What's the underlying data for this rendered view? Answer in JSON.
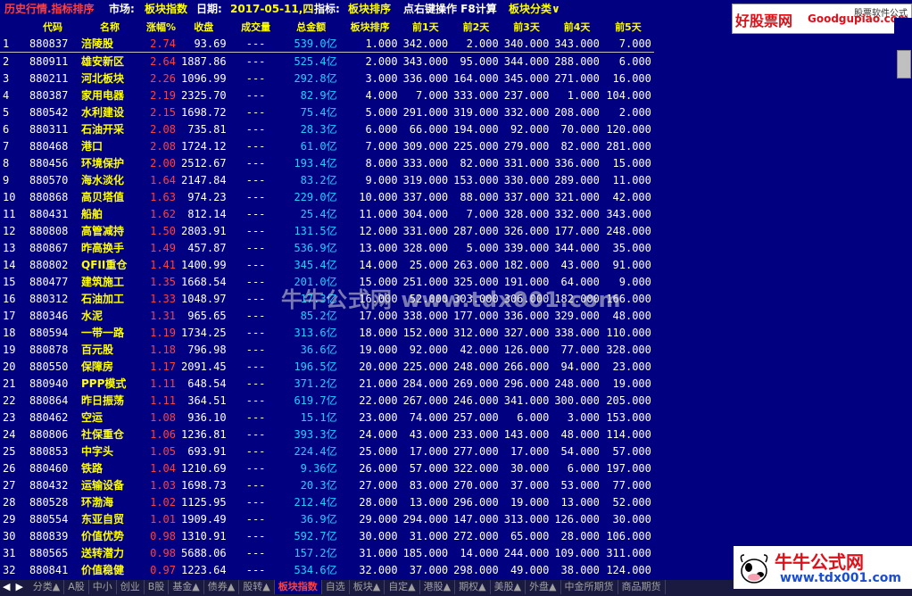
{
  "header": {
    "title": "历史行情.指标排序",
    "market_label": "市场:",
    "market_value": "板块指数",
    "date_label": "日期:",
    "date_value": "2017-05-11,四",
    "indicator_label": "指标:",
    "indicator_value": "板块排序",
    "hint": "点右键操作 F8计算",
    "category": "板块分类∨"
  },
  "brand_top": {
    "cn": "好股票网",
    "en": "Goodgupiao.com",
    "tag": "股票软件公式"
  },
  "columns": [
    "代码",
    "名称",
    "涨幅%",
    "收盘",
    "成交量",
    "总金额",
    "板块排序",
    "前1天",
    "前2天",
    "前3天",
    "前4天",
    "前5天"
  ],
  "rows": [
    [
      "1",
      "880837",
      "涪陵股",
      "2.74",
      "93.69",
      "---",
      "539.0亿",
      "1.000",
      "342.000",
      "2.000",
      "340.000",
      "343.000",
      "7.000"
    ],
    [
      "2",
      "880911",
      "雄安新区",
      "2.64",
      "1887.86",
      "---",
      "525.4亿",
      "2.000",
      "343.000",
      "95.000",
      "344.000",
      "288.000",
      "6.000"
    ],
    [
      "3",
      "880211",
      "河北板块",
      "2.26",
      "1096.99",
      "---",
      "292.8亿",
      "3.000",
      "336.000",
      "164.000",
      "345.000",
      "271.000",
      "16.000"
    ],
    [
      "4",
      "880387",
      "家用电器",
      "2.19",
      "2325.70",
      "---",
      "82.9亿",
      "4.000",
      "7.000",
      "333.000",
      "237.000",
      "1.000",
      "104.000"
    ],
    [
      "5",
      "880542",
      "水利建设",
      "2.15",
      "1698.72",
      "---",
      "75.4亿",
      "5.000",
      "291.000",
      "319.000",
      "332.000",
      "208.000",
      "2.000"
    ],
    [
      "6",
      "880311",
      "石油开采",
      "2.08",
      "735.81",
      "---",
      "28.3亿",
      "6.000",
      "66.000",
      "194.000",
      "92.000",
      "70.000",
      "120.000"
    ],
    [
      "7",
      "880468",
      "港口",
      "2.08",
      "1724.12",
      "---",
      "61.0亿",
      "7.000",
      "309.000",
      "225.000",
      "279.000",
      "82.000",
      "281.000"
    ],
    [
      "8",
      "880456",
      "环境保护",
      "2.00",
      "2512.67",
      "---",
      "193.4亿",
      "8.000",
      "333.000",
      "82.000",
      "331.000",
      "336.000",
      "15.000"
    ],
    [
      "9",
      "880570",
      "海水淡化",
      "1.64",
      "2147.84",
      "---",
      "83.2亿",
      "9.000",
      "319.000",
      "153.000",
      "330.000",
      "289.000",
      "11.000"
    ],
    [
      "10",
      "880868",
      "高贝塔值",
      "1.63",
      "974.23",
      "---",
      "229.0亿",
      "10.000",
      "337.000",
      "88.000",
      "337.000",
      "321.000",
      "42.000"
    ],
    [
      "11",
      "880431",
      "船舶",
      "1.62",
      "812.14",
      "---",
      "25.4亿",
      "11.000",
      "304.000",
      "7.000",
      "328.000",
      "332.000",
      "343.000"
    ],
    [
      "12",
      "880808",
      "高管减持",
      "1.50",
      "2803.91",
      "---",
      "131.5亿",
      "12.000",
      "331.000",
      "287.000",
      "326.000",
      "177.000",
      "248.000"
    ],
    [
      "13",
      "880867",
      "昨高换手",
      "1.49",
      "457.87",
      "---",
      "536.9亿",
      "13.000",
      "328.000",
      "5.000",
      "339.000",
      "344.000",
      "35.000"
    ],
    [
      "14",
      "880802",
      "QFII重仓",
      "1.41",
      "1400.99",
      "---",
      "345.4亿",
      "14.000",
      "25.000",
      "263.000",
      "182.000",
      "43.000",
      "91.000"
    ],
    [
      "15",
      "880477",
      "建筑施工",
      "1.35",
      "1668.54",
      "---",
      "201.0亿",
      "15.000",
      "251.000",
      "325.000",
      "191.000",
      "64.000",
      "9.000"
    ],
    [
      "16",
      "880312",
      "石油加工",
      "1.33",
      "1048.97",
      "---",
      "17.3亿",
      "16.000",
      "52.000",
      "303.000",
      "306.000",
      "182.000",
      "166.000"
    ],
    [
      "17",
      "880346",
      "水泥",
      "1.31",
      "965.65",
      "---",
      "85.2亿",
      "17.000",
      "338.000",
      "177.000",
      "336.000",
      "329.000",
      "48.000"
    ],
    [
      "18",
      "880594",
      "一带一路",
      "1.19",
      "1734.25",
      "---",
      "313.6亿",
      "18.000",
      "152.000",
      "312.000",
      "327.000",
      "338.000",
      "110.000"
    ],
    [
      "19",
      "880878",
      "百元股",
      "1.18",
      "796.98",
      "---",
      "36.6亿",
      "19.000",
      "92.000",
      "42.000",
      "126.000",
      "77.000",
      "328.000"
    ],
    [
      "20",
      "880550",
      "保障房",
      "1.17",
      "2091.45",
      "---",
      "196.5亿",
      "20.000",
      "225.000",
      "248.000",
      "266.000",
      "94.000",
      "23.000"
    ],
    [
      "21",
      "880940",
      "PPP模式",
      "1.11",
      "648.54",
      "---",
      "371.2亿",
      "21.000",
      "284.000",
      "269.000",
      "296.000",
      "248.000",
      "19.000"
    ],
    [
      "22",
      "880864",
      "昨日振荡",
      "1.11",
      "364.51",
      "---",
      "619.7亿",
      "22.000",
      "267.000",
      "246.000",
      "341.000",
      "300.000",
      "205.000"
    ],
    [
      "23",
      "880462",
      "空运",
      "1.08",
      "936.10",
      "---",
      "15.1亿",
      "23.000",
      "74.000",
      "257.000",
      "6.000",
      "3.000",
      "153.000"
    ],
    [
      "24",
      "880806",
      "社保重仓",
      "1.06",
      "1236.81",
      "---",
      "393.3亿",
      "24.000",
      "43.000",
      "233.000",
      "143.000",
      "48.000",
      "114.000"
    ],
    [
      "25",
      "880853",
      "中字头",
      "1.05",
      "693.91",
      "---",
      "224.4亿",
      "25.000",
      "17.000",
      "277.000",
      "17.000",
      "54.000",
      "57.000"
    ],
    [
      "26",
      "880460",
      "铁路",
      "1.04",
      "1210.69",
      "---",
      "9.36亿",
      "26.000",
      "57.000",
      "322.000",
      "30.000",
      "6.000",
      "197.000"
    ],
    [
      "27",
      "880432",
      "运输设备",
      "1.03",
      "1698.73",
      "---",
      "20.3亿",
      "27.000",
      "83.000",
      "270.000",
      "37.000",
      "53.000",
      "77.000"
    ],
    [
      "28",
      "880528",
      "环渤海",
      "1.02",
      "1125.95",
      "---",
      "212.4亿",
      "28.000",
      "13.000",
      "296.000",
      "19.000",
      "13.000",
      "52.000"
    ],
    [
      "29",
      "880554",
      "东亚自贸",
      "1.01",
      "1909.49",
      "---",
      "36.9亿",
      "29.000",
      "294.000",
      "147.000",
      "313.000",
      "126.000",
      "30.000"
    ],
    [
      "30",
      "880839",
      "价值优势",
      "0.98",
      "1310.91",
      "---",
      "592.7亿",
      "30.000",
      "31.000",
      "272.000",
      "65.000",
      "28.000",
      "106.000"
    ],
    [
      "31",
      "880565",
      "送转潜力",
      "0.98",
      "5688.06",
      "---",
      "157.2亿",
      "31.000",
      "185.000",
      "14.000",
      "244.000",
      "109.000",
      "311.000"
    ],
    [
      "32",
      "880841",
      "价值稳健",
      "0.97",
      "1223.64",
      "---",
      "534.6亿",
      "32.000",
      "37.000",
      "298.000",
      "49.000",
      "38.000",
      "124.000"
    ]
  ],
  "watermark": "牛牛公式网 www.tdx001.com",
  "tabs": [
    "分类▲",
    "A股",
    "中小",
    "创业",
    "B股",
    "基金▲",
    "债券▲",
    "股转▲",
    "板块指数",
    "自选",
    "板块▲",
    "自定▲",
    "港股▲",
    "期权▲",
    "美股▲",
    "外盘▲",
    "中金所期货",
    "商品期货"
  ],
  "active_tab": "板块指数",
  "brand_bottom": {
    "cn": "牛牛公式网",
    "en": "www.tdx001.com"
  }
}
